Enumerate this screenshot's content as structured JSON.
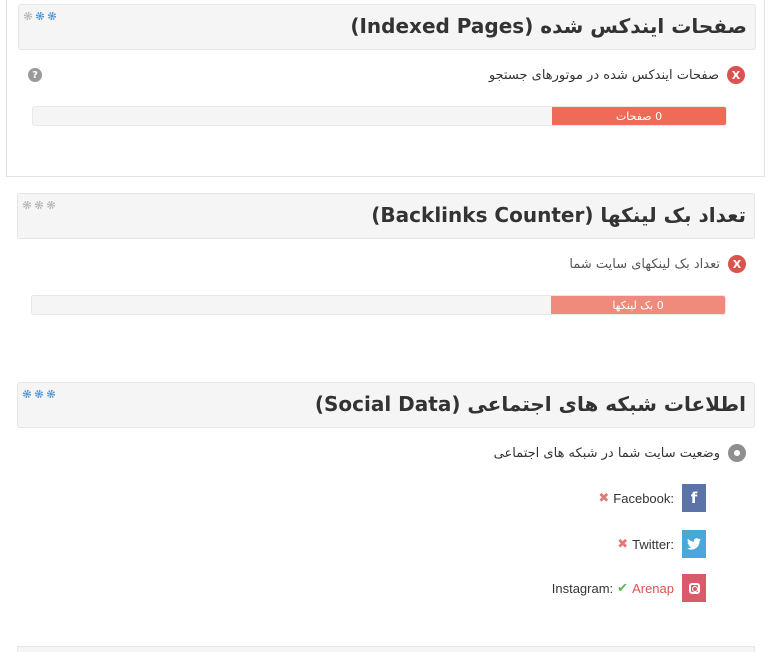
{
  "colors": {
    "error": "#d9534f",
    "bar_fill_primary": "#ef6a57",
    "bar_fill_secondary": "#f08a7c",
    "gear": "#5a9bd5",
    "gear_inactive": "#b9b9b9",
    "facebook": "#5b73a8",
    "twitter": "#4aa7d9",
    "instagram": "#d95a6a",
    "success": "#5cb85c"
  },
  "indexed": {
    "title": "صفحات ایندکس شده (Indexed Pages)",
    "gear_icons": [
      "gear-icon",
      "gear-icon",
      "gear-icon"
    ],
    "status_icon": "x-circle-icon",
    "status_text": "صفحات ایندکس شده در موتورهای جستجو",
    "help_icon": "question-circle-icon",
    "help_glyph": "?",
    "bar_label": "0 صفحات",
    "bar_value": 0
  },
  "backlinks": {
    "title": "تعداد بک لینکها (Backlinks Counter)",
    "gear_icons": [
      "gear-icon",
      "gear-icon",
      "gear-icon"
    ],
    "status_icon": "x-circle-icon",
    "status_text": "تعداد بک لینکهای سایت شما",
    "bar_label": "0 بک لینکها",
    "bar_value": 0
  },
  "social": {
    "title": "اطلاعات شبکه های اجتماعی (Social Data)",
    "gear_icons": [
      "gear-icon",
      "gear-icon",
      "gear-icon"
    ],
    "status_icon": "info-circle-icon",
    "status_text": "وضعیت سایت شما در شبکه های اجتماعی",
    "networks": [
      {
        "name": "Facebook:",
        "icon": "facebook-icon",
        "status": "cross",
        "status_icon": "x-icon",
        "glyph": "f"
      },
      {
        "name": "Twitter:",
        "icon": "twitter-icon",
        "status": "cross",
        "status_icon": "x-icon",
        "glyph": "t"
      },
      {
        "name": "Instagram:",
        "icon": "instagram-icon",
        "status": "check",
        "status_icon": "check-icon",
        "username": "Arenap"
      }
    ]
  }
}
